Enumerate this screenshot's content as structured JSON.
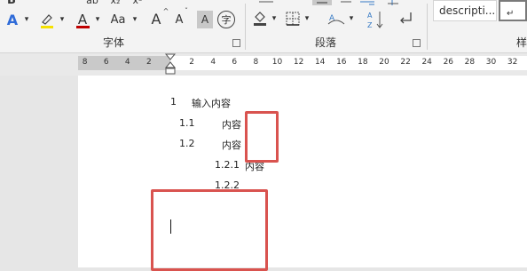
{
  "ribbon": {
    "row1": [
      "B",
      "ab",
      "x₂",
      "x²"
    ],
    "font_group_label": "字体",
    "paragraph_group_label": "段落",
    "styles_group_label": "样",
    "font_size_button": "Aa",
    "grow_font": "A",
    "shrink_font": "A",
    "char_shading": "A",
    "enclose_char": "字",
    "style_description": "descripti...",
    "style_normal_marker": "↵",
    "colors": {
      "highlight": "#f5e100",
      "font_color": "#c00000",
      "text_effect": "#2f6bd8",
      "accent": "#d9534f"
    }
  },
  "ruler": {
    "left_numbers": [
      "8",
      "6",
      "4",
      "2"
    ],
    "right_numbers": [
      "2",
      "4",
      "6",
      "8",
      "10",
      "12",
      "14",
      "16",
      "18",
      "20",
      "22",
      "24",
      "26",
      "28",
      "30",
      "32"
    ]
  },
  "document": {
    "lines": [
      {
        "num": "1",
        "text": "输入内容"
      },
      {
        "num": "1.1",
        "text": "内容"
      },
      {
        "num": "1.2",
        "text": "内容"
      },
      {
        "num": "1.2.1",
        "text": "内容"
      },
      {
        "num": "1.2.2",
        "text": ""
      }
    ]
  }
}
